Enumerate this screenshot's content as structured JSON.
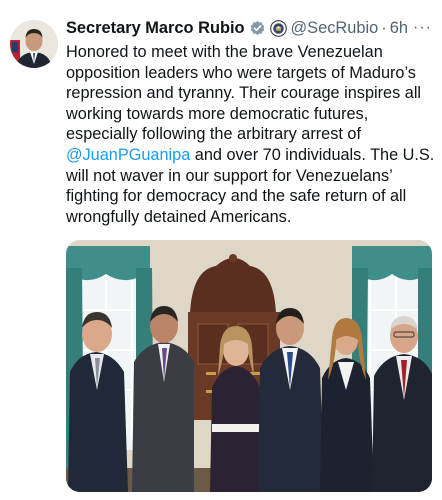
{
  "tweet": {
    "author_name": "Secretary Marco Rubio",
    "handle": "@SecRubio",
    "separator": "·",
    "time": "6h",
    "more_label": "···",
    "text_part1": "Honored to meet with the brave Venezuelan opposition leaders who were targets of Maduro’s repression and tyranny. Their courage inspires all working towards more democratic futures, especially following the arbitrary arrest of ",
    "mention": "@JuanPGuanipa",
    "text_part2": " and over 70 individuals. The U.S. will not waver in our support for Venezuelans’ fighting for democracy and the safe return of all wrongfully detained Americans."
  },
  "icons": {
    "verified": "verified-badge-icon",
    "affiliate": "government-seal-icon",
    "more": "more-options-icon"
  },
  "colors": {
    "text": "#0f1419",
    "secondary": "#536471",
    "link": "#1d9bf0",
    "verified_badge": "#829aab"
  }
}
